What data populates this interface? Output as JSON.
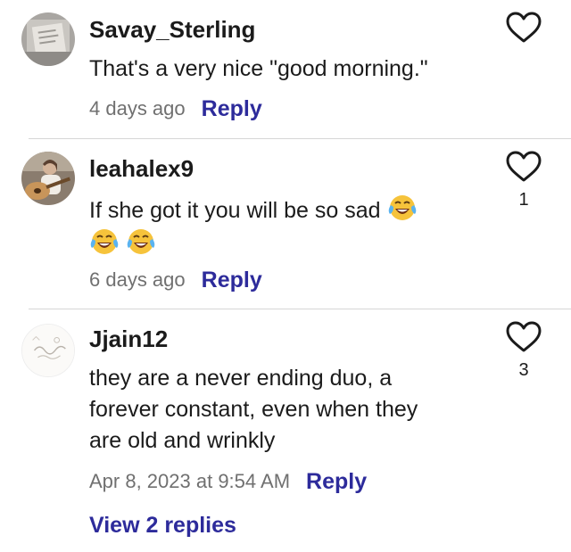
{
  "comments": [
    {
      "username": "Savay_Sterling",
      "text": "That's a very nice \"good morning.\"",
      "timestamp": "4 days ago",
      "reply_label": "Reply",
      "likes": "",
      "avatar_icon": "book-avatar"
    },
    {
      "username": "leahalex9",
      "text": "If she got it you will be so sad",
      "emoji_icon": "face-with-tears-of-joy-icon",
      "timestamp": "6 days ago",
      "reply_label": "Reply",
      "likes": "1",
      "avatar_icon": "guitar-avatar"
    },
    {
      "username": "Jjain12",
      "text": "they are a never ending duo, a forever constant, even when they are old and wrinkly",
      "timestamp": "Apr 8, 2023 at 9:54 AM",
      "reply_label": "Reply",
      "likes": "3",
      "view_replies_label": "View 2 replies",
      "avatar_icon": "sketch-avatar"
    }
  ],
  "colors": {
    "accent": "#2d2b9b",
    "text": "#1b1b1b",
    "muted": "#707070",
    "divider": "#d6d6d6"
  }
}
